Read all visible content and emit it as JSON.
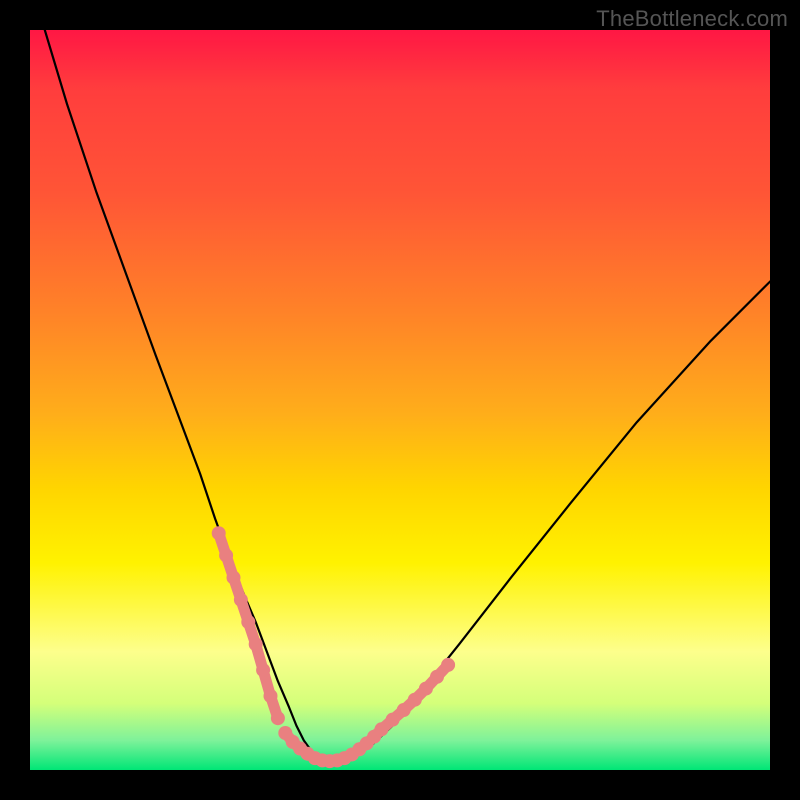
{
  "watermark": "TheBottleneck.com",
  "chart_data": {
    "type": "line",
    "title": "",
    "xlabel": "",
    "ylabel": "",
    "xlim": [
      0,
      100
    ],
    "ylim": [
      0,
      100
    ],
    "series": [
      {
        "name": "curve",
        "x": [
          2,
          5,
          9,
          13,
          17,
          20,
          23,
          25,
          27,
          29,
          30.5,
          32,
          33.5,
          35,
          36,
          37,
          38,
          39.5,
          41,
          43,
          46,
          49,
          52,
          58,
          65,
          73,
          82,
          92,
          100
        ],
        "values": [
          100,
          90,
          78,
          67,
          56,
          48,
          40,
          34,
          28.5,
          23.5,
          20,
          16,
          12,
          8.5,
          6,
          4,
          2.6,
          1.5,
          1.2,
          1.5,
          3.2,
          6,
          9.5,
          17,
          26,
          36,
          47,
          58,
          66
        ]
      }
    ],
    "markers_left": {
      "name": "highlight-left",
      "x": [
        25.5,
        26.5,
        27.5,
        28.5,
        29.5,
        30.5,
        31.5,
        32.5,
        33.5
      ],
      "values": [
        32,
        29,
        26,
        23,
        20,
        17,
        13.5,
        10,
        7
      ]
    },
    "markers_bottom": {
      "name": "highlight-bottom",
      "x": [
        34.5,
        35.5,
        36.5,
        37.5,
        38.5,
        39.5,
        40.5,
        41.5,
        42.5,
        43.5
      ],
      "values": [
        5,
        3.8,
        2.9,
        2.2,
        1.6,
        1.3,
        1.2,
        1.3,
        1.6,
        2.1
      ]
    },
    "markers_right": {
      "name": "highlight-right",
      "x": [
        44.5,
        45.5,
        46.5,
        47.5,
        49,
        50.5,
        52,
        53.5,
        55,
        56.5
      ],
      "values": [
        2.8,
        3.6,
        4.5,
        5.5,
        6.8,
        8.1,
        9.5,
        11,
        12.6,
        14.2
      ]
    },
    "colors": {
      "curve": "#000000",
      "marker": "#e98080"
    }
  }
}
